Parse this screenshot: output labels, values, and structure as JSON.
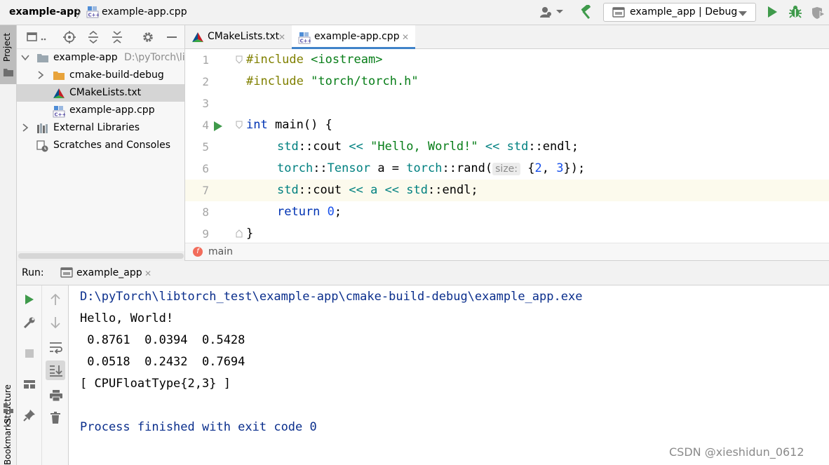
{
  "navbar": {
    "project": "example-app",
    "separator": "〉",
    "file": "example-app.cpp",
    "run_config": "example_app | Debug"
  },
  "left_stripe": {
    "project": "Project",
    "structure": "Structure",
    "bookmarks": "Bookmarks"
  },
  "project_tree": {
    "root": {
      "label": "example-app",
      "path": "D:\\pyTorch\\libtorch_test\\example-app"
    },
    "items": [
      {
        "label": "cmake-build-debug",
        "icon": "folder-icon"
      },
      {
        "label": "CMakeLists.txt",
        "icon": "cmake-icon"
      },
      {
        "label": "example-app.cpp",
        "icon": "cpp-file-icon"
      }
    ],
    "external_libraries": "External Libraries",
    "scratches": "Scratches and Consoles"
  },
  "editor_tabs": [
    {
      "label": "CMakeLists.txt",
      "close": "✕"
    },
    {
      "label": "example-app.cpp",
      "close": "✕"
    }
  ],
  "code": {
    "line_numbers": [
      "1",
      "2",
      "3",
      "4",
      "5",
      "6",
      "7",
      "8",
      "9"
    ],
    "l1": {
      "directive": "#include",
      "rest": " <iostream>"
    },
    "l2": {
      "directive": "#include",
      "rest": " \"torch/torch.h\""
    },
    "l4": {
      "type": "int",
      "rest": " main() {"
    },
    "l5": {
      "ns1": "std",
      "sep1": "::",
      "name1": "cout",
      "op1": " << ",
      "str": "\"Hello, World!\"",
      "op2": " << ",
      "ns2": "std",
      "sep2": "::",
      "name2": "endl;"
    },
    "l6": {
      "ns1": "torch",
      "sep1": "::",
      "type": "Tensor",
      "mid": " a = ",
      "ns2": "torch",
      "sep2": "::",
      "fn": "rand(",
      "hint": "size:",
      "b1": " {",
      "n1": "2",
      "comma": ", ",
      "n2": "3",
      "end": "});"
    },
    "l7": {
      "ns1": "std",
      "sep1": "::",
      "name1": "cout",
      "op": " << a << ",
      "ns2": "std",
      "sep2": "::",
      "name2": "endl;"
    },
    "l8": {
      "kw": "return",
      "sp": " ",
      "num": "0",
      "end": ";"
    },
    "l9": {
      "brace": "}"
    }
  },
  "breadcrumb": {
    "icon_letter": "f",
    "label": "main"
  },
  "run_panel": {
    "label": "Run:",
    "tab": "example_app",
    "tab_close": "✕"
  },
  "console": {
    "lines": [
      "D:\\pyTorch\\libtorch_test\\example-app\\cmake-build-debug\\example_app.exe",
      "Hello, World!",
      " 0.8761  0.0394  0.5428",
      " 0.0518  0.2432  0.7694",
      "[ CPUFloatType{2,3} ]",
      "",
      "Process finished with exit code 0"
    ]
  },
  "watermark": "CSDN @xieshidun_0612",
  "colors": {
    "accent": "#4083c9",
    "run_green": "#3f9a4b",
    "current_line": "#fcfaed"
  }
}
